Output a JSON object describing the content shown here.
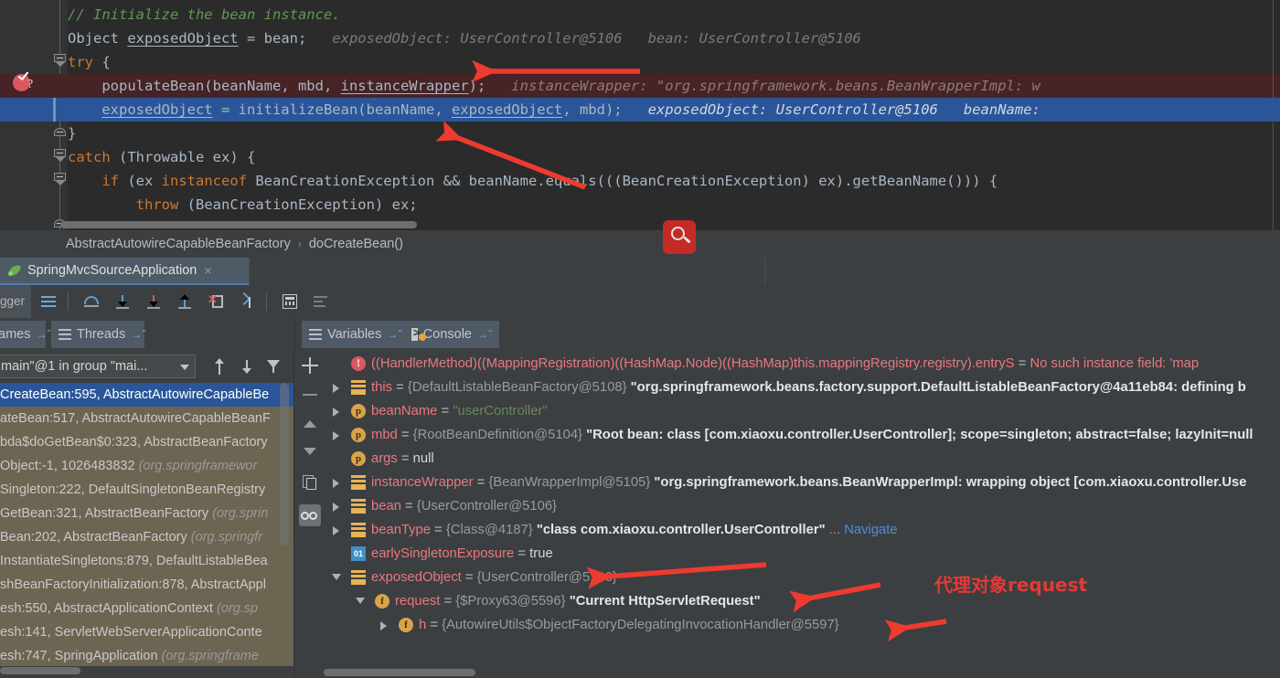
{
  "editor": {
    "lines": [
      {
        "indent": 0,
        "segments": [
          {
            "t": "// Initialize the bean instance.",
            "c": "cmt"
          }
        ]
      },
      {
        "indent": 0,
        "segments": [
          {
            "t": "Object ",
            "c": ""
          },
          {
            "t": "exposedObject",
            "c": "u"
          },
          {
            "t": " = bean;",
            "c": ""
          },
          {
            "t": "   exposedObject: UserController@5106   bean: UserController@5106",
            "c": "hintx"
          }
        ]
      },
      {
        "indent": 0,
        "segments": [
          {
            "t": "try",
            "c": "kw"
          },
          {
            "t": " {",
            "c": ""
          }
        ]
      },
      {
        "indent": 1,
        "segments": [
          {
            "t": "populateBean(beanName, mbd, ",
            "c": ""
          },
          {
            "t": "instanceWrapper",
            "c": "u"
          },
          {
            "t": ");",
            "c": ""
          },
          {
            "t": "   instanceWrapper: \"org.springframework.beans.BeanWrapperImpl: w",
            "c": "hintx-red"
          }
        ]
      },
      {
        "indent": 1,
        "segments": [
          {
            "t": "exposedObject",
            "c": "u"
          },
          {
            "t": " = initializeBean(beanName, ",
            "c": ""
          },
          {
            "t": "exposedObject",
            "c": "u"
          },
          {
            "t": ", mbd);",
            "c": ""
          },
          {
            "t": "   exposedObject: UserController@5106   beanName:",
            "c": "hintx-sel"
          }
        ]
      },
      {
        "indent": 0,
        "segments": [
          {
            "t": "}",
            "c": ""
          }
        ]
      },
      {
        "indent": 0,
        "segments": [
          {
            "t": "catch",
            "c": "kw"
          },
          {
            "t": " (Throwable ex) {",
            "c": ""
          }
        ]
      },
      {
        "indent": 1,
        "segments": [
          {
            "t": "if",
            "c": "kw"
          },
          {
            "t": " (ex ",
            "c": ""
          },
          {
            "t": "instanceof",
            "c": "kw"
          },
          {
            "t": " BeanCreationException && beanName.equals(((BeanCreationException) ex).getBeanName())) {",
            "c": ""
          }
        ]
      },
      {
        "indent": 2,
        "segments": [
          {
            "t": "throw",
            "c": "kw"
          },
          {
            "t": " (BeanCreationException) ex;",
            "c": ""
          }
        ]
      }
    ],
    "breakpoint_icon": "breakpoint-check-question",
    "breakpoint_line_index": 3,
    "execution_line_index": 4
  },
  "breadcrumb": {
    "items": [
      "AbstractAutowireCapableBeanFactory",
      "doCreateBean()"
    ],
    "separator": "›"
  },
  "run_tab": {
    "icon": "spring-leaf-icon",
    "label": "SpringMvcSourceApplication",
    "close": "×"
  },
  "debugger_toolbar": {
    "side_label": "gger",
    "buttons": [
      {
        "name": "show-execution-point-button",
        "icon": "hamburger-blue-icon"
      },
      {
        "name": "step-over-button",
        "icon": "step-over-icon"
      },
      {
        "name": "step-into-button",
        "icon": "step-into-icon"
      },
      {
        "name": "force-step-into-button",
        "icon": "force-step-into-icon"
      },
      {
        "name": "step-out-button",
        "icon": "step-out-icon"
      },
      {
        "name": "drop-frame-button",
        "icon": "drop-frame-icon"
      },
      {
        "name": "run-to-cursor-button",
        "icon": "run-to-cursor-icon"
      },
      {
        "name": "evaluate-expression-button",
        "icon": "calculator-icon"
      },
      {
        "name": "layout-settings-button",
        "icon": "layers-icon"
      }
    ]
  },
  "sub_tabs": {
    "frames": {
      "label": "ames",
      "pin": "→˝",
      "icon": "list-icon"
    },
    "threads": {
      "label": "Threads",
      "pin": "→˝",
      "icon": "threads-icon"
    },
    "variables": {
      "label": "Variables",
      "pin": "→˝",
      "icon": "list-icon"
    },
    "console": {
      "label": "Console",
      "pin": "→˝",
      "icon": "console-icon"
    }
  },
  "frames_panel": {
    "thread_selector": "main\"@1 in group \"mai...",
    "toolbar": [
      {
        "name": "frames-up-button",
        "icon": "arrow-up-icon"
      },
      {
        "name": "frames-down-button",
        "icon": "arrow-down-icon"
      },
      {
        "name": "frames-filter-button",
        "icon": "filter-icon"
      }
    ],
    "rows": [
      {
        "main": "CreateBean:595, AbstractAutowireCapableBe",
        "pkg": "",
        "selected": true
      },
      {
        "main": "ateBean:517, AbstractAutowireCapableBeanF",
        "pkg": "",
        "selected": false
      },
      {
        "main": "bda$doGetBean$0:323, AbstractBeanFactory",
        "pkg": "",
        "selected": false
      },
      {
        "main": "Object:-1, 1026483832 ",
        "pkg": "(org.springframewor",
        "selected": false
      },
      {
        "main": "Singleton:222, DefaultSingletonBeanRegistry",
        "pkg": "",
        "selected": false
      },
      {
        "main": "GetBean:321, AbstractBeanFactory ",
        "pkg": "(org.sprin",
        "selected": false
      },
      {
        "main": "Bean:202, AbstractBeanFactory ",
        "pkg": "(org.springfr",
        "selected": false
      },
      {
        "main": "InstantiateSingletons:879, DefaultListableBea",
        "pkg": "",
        "selected": false
      },
      {
        "main": "shBeanFactoryInitialization:878, AbstractAppl",
        "pkg": "",
        "selected": false
      },
      {
        "main": "esh:550, AbstractApplicationContext ",
        "pkg": "(org.sp",
        "selected": false
      },
      {
        "main": "esh:141, ServletWebServerApplicationConte",
        "pkg": "",
        "selected": false
      },
      {
        "main": "esh:747, SpringApplication ",
        "pkg": "(org.springframe",
        "selected": false
      }
    ]
  },
  "vars_toolbar": {
    "buttons": [
      {
        "name": "add-watch-button",
        "icon": "plus-icon"
      },
      {
        "name": "remove-watch-button",
        "icon": "minus-icon"
      },
      {
        "name": "move-up-button",
        "icon": "triangle-up-icon"
      },
      {
        "name": "move-down-button",
        "icon": "triangle-down-icon"
      },
      {
        "name": "copy-value-button",
        "icon": "copy-icon"
      },
      {
        "name": "watches-toggle-button",
        "icon": "glasses-icon"
      }
    ]
  },
  "variables": [
    {
      "indent": 0,
      "toggle": "none",
      "icon": "error-icon",
      "parts": [
        {
          "t": "((HandlerMethod)((MappingRegistration)((HashMap.Node)((HashMap)this.mappingRegistry.registry).entryS",
          "c": "verr"
        },
        {
          "t": " = ",
          "c": "veq"
        },
        {
          "t": "No such instance field: 'map",
          "c": "verr"
        }
      ]
    },
    {
      "indent": 0,
      "toggle": "collapsed",
      "icon": "object-icon",
      "parts": [
        {
          "t": "this",
          "c": "vname"
        },
        {
          "t": " = ",
          "c": "veq"
        },
        {
          "t": "{DefaultListableBeanFactory@5108}",
          "c": "vref"
        },
        {
          "t": " \"org.springframework.beans.factory.support.DefaultListableBeanFactory@4a11eb84: defining b",
          "c": "vval"
        }
      ]
    },
    {
      "indent": 0,
      "toggle": "collapsed",
      "icon": "param-icon",
      "parts": [
        {
          "t": "beanName",
          "c": "vname"
        },
        {
          "t": " = ",
          "c": "veq"
        },
        {
          "t": "\"userController\"",
          "c": "vstr"
        }
      ]
    },
    {
      "indent": 0,
      "toggle": "collapsed",
      "icon": "param-icon",
      "parts": [
        {
          "t": "mbd",
          "c": "vname"
        },
        {
          "t": " = ",
          "c": "veq"
        },
        {
          "t": "{RootBeanDefinition@5104}",
          "c": "vref"
        },
        {
          "t": " \"Root bean: class [com.xiaoxu.controller.UserController]; scope=singleton; abstract=false; lazyInit=null",
          "c": "vval"
        }
      ]
    },
    {
      "indent": 0,
      "toggle": "none",
      "icon": "param-icon",
      "parts": [
        {
          "t": "args",
          "c": "vname"
        },
        {
          "t": " = ",
          "c": "veq"
        },
        {
          "t": "null",
          "c": "vplain"
        }
      ]
    },
    {
      "indent": 0,
      "toggle": "collapsed",
      "icon": "object-icon",
      "parts": [
        {
          "t": "instanceWrapper",
          "c": "vname"
        },
        {
          "t": " = ",
          "c": "veq"
        },
        {
          "t": "{BeanWrapperImpl@5105}",
          "c": "vref"
        },
        {
          "t": " \"org.springframework.beans.BeanWrapperImpl: wrapping object [com.xiaoxu.controller.Use",
          "c": "vval"
        }
      ]
    },
    {
      "indent": 0,
      "toggle": "collapsed",
      "icon": "object-icon",
      "parts": [
        {
          "t": "bean",
          "c": "vname"
        },
        {
          "t": " = ",
          "c": "veq"
        },
        {
          "t": "{UserController@5106}",
          "c": "vref"
        }
      ]
    },
    {
      "indent": 0,
      "toggle": "collapsed",
      "icon": "object-icon",
      "parts": [
        {
          "t": "beanType",
          "c": "vname"
        },
        {
          "t": " = ",
          "c": "veq"
        },
        {
          "t": "{Class@4187}",
          "c": "vref"
        },
        {
          "t": " \"class com.xiaoxu.controller.UserController\"",
          "c": "vval"
        },
        {
          "t": " ... ",
          "c": "vref"
        },
        {
          "t": "Navigate",
          "c": "vnav"
        }
      ]
    },
    {
      "indent": 0,
      "toggle": "none",
      "icon": "boolean-icon",
      "parts": [
        {
          "t": "earlySingletonExposure",
          "c": "vname"
        },
        {
          "t": " = ",
          "c": "veq"
        },
        {
          "t": "true",
          "c": "vplain"
        }
      ]
    },
    {
      "indent": 0,
      "toggle": "expanded",
      "icon": "object-icon",
      "parts": [
        {
          "t": "exposedObject",
          "c": "vname"
        },
        {
          "t": " = ",
          "c": "veq"
        },
        {
          "t": "{UserController@5106}",
          "c": "vref"
        }
      ]
    },
    {
      "indent": 1,
      "toggle": "expanded",
      "icon": "field-icon",
      "parts": [
        {
          "t": "request",
          "c": "vname"
        },
        {
          "t": " = ",
          "c": "veq"
        },
        {
          "t": "{$Proxy63@5596}",
          "c": "vref"
        },
        {
          "t": " \"Current HttpServletRequest\"",
          "c": "vval"
        }
      ]
    },
    {
      "indent": 2,
      "toggle": "collapsed",
      "icon": "field-icon",
      "parts": [
        {
          "t": "h",
          "c": "vname"
        },
        {
          "t": " = ",
          "c": "veq"
        },
        {
          "t": "{AutowireUtils$ObjectFactoryDelegatingInvocationHandler@5597}",
          "c": "vref"
        }
      ]
    }
  ],
  "annotations": {
    "text": "代理对象request",
    "color": "#e53935",
    "arrows": [
      {
        "name": "arrow-to-populate-bean"
      },
      {
        "name": "arrow-to-try-block"
      },
      {
        "name": "arrow-to-exposed-object"
      },
      {
        "name": "arrow-to-request-field"
      },
      {
        "name": "arrow-to-handler-field"
      }
    ]
  },
  "search_cursor": {
    "icon": "search-magnifier-icon",
    "color": "#c42b24"
  }
}
